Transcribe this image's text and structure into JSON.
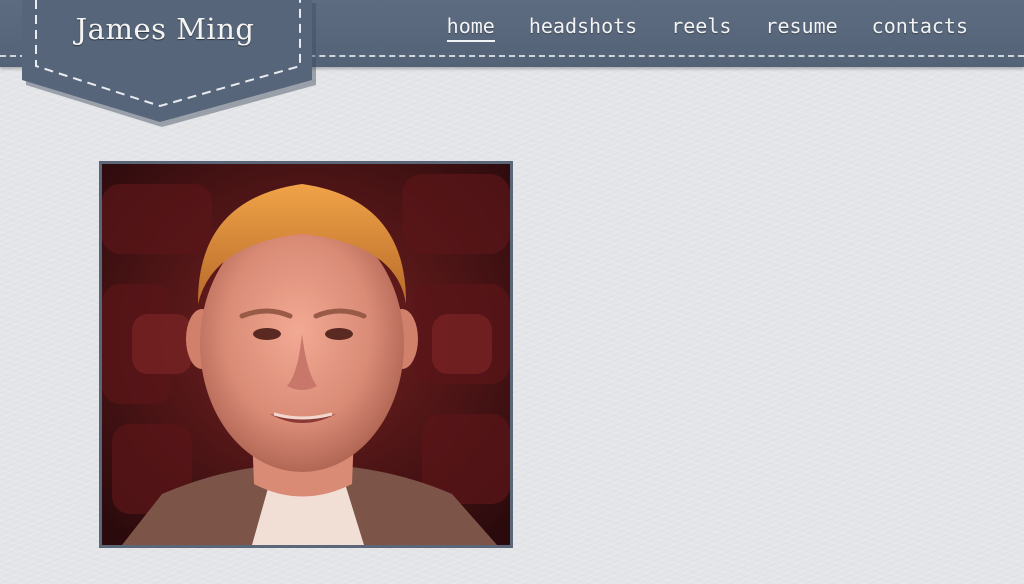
{
  "site": {
    "name": "James Ming"
  },
  "nav": {
    "items": [
      {
        "label": "home",
        "active": true
      },
      {
        "label": "headshots",
        "active": false
      },
      {
        "label": "reels",
        "active": false
      },
      {
        "label": "resume",
        "active": false
      },
      {
        "label": "contacts",
        "active": false
      }
    ]
  },
  "colors": {
    "header": "#57667a",
    "stitch": "#e6e9ee",
    "background": "#e4e5e8",
    "photo_border": "#5c6679"
  },
  "photo": {
    "icon": "portrait-photo"
  }
}
